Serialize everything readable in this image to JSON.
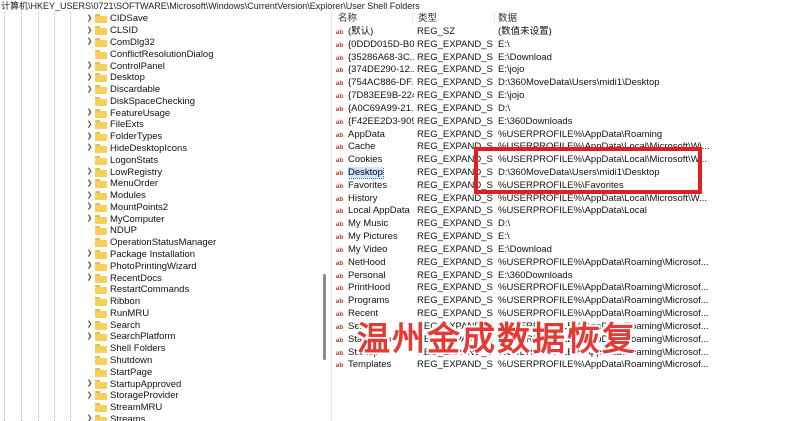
{
  "address_bar": "计算机\\HKEY_USERS\\0721\\SOFTWARE\\Microsoft\\Windows\\CurrentVersion\\Explorer\\User Shell Folders",
  "tree": {
    "items": [
      {
        "label": "CIDSave",
        "expandable": true
      },
      {
        "label": "CLSID",
        "expandable": true
      },
      {
        "label": "ComDlg32",
        "expandable": true
      },
      {
        "label": "ConflictResolutionDialog",
        "expandable": false
      },
      {
        "label": "ControlPanel",
        "expandable": true
      },
      {
        "label": "Desktop",
        "expandable": true
      },
      {
        "label": "Discardable",
        "expandable": true
      },
      {
        "label": "DiskSpaceChecking",
        "expandable": false
      },
      {
        "label": "FeatureUsage",
        "expandable": true
      },
      {
        "label": "FileExts",
        "expandable": true
      },
      {
        "label": "FolderTypes",
        "expandable": true
      },
      {
        "label": "HideDesktopIcons",
        "expandable": true
      },
      {
        "label": "LogonStats",
        "expandable": false
      },
      {
        "label": "LowRegistry",
        "expandable": true
      },
      {
        "label": "MenuOrder",
        "expandable": true
      },
      {
        "label": "Modules",
        "expandable": true
      },
      {
        "label": "MountPoints2",
        "expandable": true
      },
      {
        "label": "MyComputer",
        "expandable": true
      },
      {
        "label": "NDUP",
        "expandable": false
      },
      {
        "label": "OperationStatusManager",
        "expandable": false
      },
      {
        "label": "Package Installation",
        "expandable": true
      },
      {
        "label": "PhotoPrintingWizard",
        "expandable": true
      },
      {
        "label": "RecentDocs",
        "expandable": true
      },
      {
        "label": "RestartCommands",
        "expandable": false
      },
      {
        "label": "Ribbon",
        "expandable": false
      },
      {
        "label": "RunMRU",
        "expandable": false
      },
      {
        "label": "Search",
        "expandable": true
      },
      {
        "label": "SearchPlatform",
        "expandable": true
      },
      {
        "label": "Shell Folders",
        "expandable": false
      },
      {
        "label": "Shutdown",
        "expandable": false
      },
      {
        "label": "StartPage",
        "expandable": false
      },
      {
        "label": "StartupApproved",
        "expandable": true
      },
      {
        "label": "StorageProvider",
        "expandable": true
      },
      {
        "label": "StreamMRU",
        "expandable": false
      },
      {
        "label": "Streams",
        "expandable": true
      }
    ]
  },
  "columns": {
    "name": "名称",
    "type": "类型",
    "data": "数据"
  },
  "rows": [
    {
      "name": "(默认)",
      "type": "REG_SZ",
      "data": "(数值未设置)"
    },
    {
      "name": "{0DDD015D-B0...",
      "type": "REG_EXPAND_SZ",
      "data": "E:\\"
    },
    {
      "name": "{35286A68-3C...",
      "type": "REG_EXPAND_SZ",
      "data": "E:\\Download"
    },
    {
      "name": "{374DE290-12...",
      "type": "REG_EXPAND_SZ",
      "data": "E:\\jojo"
    },
    {
      "name": "{754AC886-DF...",
      "type": "REG_EXPAND_SZ",
      "data": "D:\\360MoveData\\Users\\midi1\\Desktop"
    },
    {
      "name": "{7D83EE9B-224...",
      "type": "REG_EXPAND_SZ",
      "data": "E:\\jojo"
    },
    {
      "name": "{A0C69A99-21...",
      "type": "REG_EXPAND_SZ",
      "data": "D:\\"
    },
    {
      "name": "{F42EE2D3-909...",
      "type": "REG_EXPAND_SZ",
      "data": "E:\\360Downloads"
    },
    {
      "name": "AppData",
      "type": "REG_EXPAND_SZ",
      "data": "%USERPROFILE%\\AppData\\Roaming"
    },
    {
      "name": "Cache",
      "type": "REG_EXPAND_SZ",
      "data": "%USERPROFILE%\\AppData\\Local\\Microsoft\\Wi..."
    },
    {
      "name": "Cookies",
      "type": "REG_EXPAND_SZ",
      "data": "%USERPROFILE%\\AppData\\Local\\Microsoft\\W..."
    },
    {
      "name": "Desktop",
      "type": "REG_EXPAND_SZ",
      "data": "D:\\360MoveData\\Users\\midi1\\Desktop",
      "selected": true
    },
    {
      "name": "Favorites",
      "type": "REG_EXPAND_SZ",
      "data": "%USERPROFILE%\\Favorites"
    },
    {
      "name": "History",
      "type": "REG_EXPAND_SZ",
      "data": "%USERPROFILE%\\AppData\\Local\\Microsoft\\W..."
    },
    {
      "name": "Local AppData",
      "type": "REG_EXPAND_SZ",
      "data": "%USERPROFILE%\\AppData\\Local"
    },
    {
      "name": "My Music",
      "type": "REG_EXPAND_SZ",
      "data": "D:\\"
    },
    {
      "name": "My Pictures",
      "type": "REG_EXPAND_SZ",
      "data": "E:\\"
    },
    {
      "name": "My Video",
      "type": "REG_EXPAND_SZ",
      "data": "E:\\Download"
    },
    {
      "name": "NetHood",
      "type": "REG_EXPAND_SZ",
      "data": "%USERPROFILE%\\AppData\\Roaming\\Microsof..."
    },
    {
      "name": "Personal",
      "type": "REG_EXPAND_SZ",
      "data": "E:\\360Downloads"
    },
    {
      "name": "PrintHood",
      "type": "REG_EXPAND_SZ",
      "data": "%USERPROFILE%\\AppData\\Roaming\\Microsof..."
    },
    {
      "name": "Programs",
      "type": "REG_EXPAND_SZ",
      "data": "%USERPROFILE%\\AppData\\Roaming\\Microsof..."
    },
    {
      "name": "Recent",
      "type": "REG_EXPAND_SZ",
      "data": "%USERPROFILE%\\AppData\\Roaming\\Microsof..."
    },
    {
      "name": "SendTo",
      "type": "REG_EXPAND_SZ",
      "data": "%USERPROFILE%\\AppData\\Roaming\\Microsof..."
    },
    {
      "name": "Start Menu",
      "type": "REG_EXPAND_SZ",
      "data": "%USERPROFILE%\\AppData\\Roaming\\Microsof..."
    },
    {
      "name": "Startup",
      "type": "REG_EXPAND_SZ",
      "data": "%USERPROFILE%\\AppData\\Roaming\\Microsof..."
    },
    {
      "name": "Templates",
      "type": "REG_EXPAND_SZ",
      "data": "%USERPROFILE%\\AppData\\Roaming\\Microsof..."
    }
  ],
  "value_icon_text": "ab",
  "watermark": "温州金成数据恢复",
  "colors": {
    "highlight_box": "#e02020",
    "watermark": "#e53935",
    "selection": "#cfe3fb",
    "folder": "#f6cf5c"
  }
}
